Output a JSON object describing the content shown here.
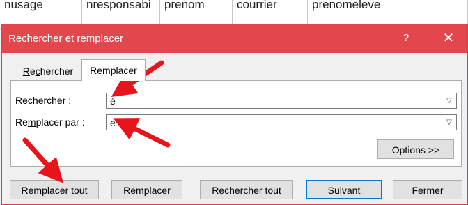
{
  "sheet": {
    "columns": [
      "nusage",
      "nresponsabi",
      "prenom",
      "courrier",
      "prenomeleve"
    ]
  },
  "dialog": {
    "title": "Rechercher et remplacer",
    "help_glyph": "?",
    "close_glyph": "✕",
    "tabs": [
      {
        "label": "Rechercher",
        "active": false
      },
      {
        "label": "Remplacer",
        "active": true
      }
    ],
    "find": {
      "label": "Rechercher :",
      "value": "é"
    },
    "replace": {
      "label": "Remplacer par :",
      "value": "e"
    },
    "buttons": {
      "options": "Options >>",
      "replace_all": "Remplacer tout",
      "replace": "Remplacer",
      "find_all": "Rechercher tout",
      "next": "Suivant",
      "close": "Fermer"
    }
  },
  "colors": {
    "titlebar": "#e4464e",
    "annotation_arrow": "#e8141c",
    "default_button_border": "#0078d7"
  },
  "annotations": {
    "arrow_count": 4,
    "icon": "red-arrow-icon"
  }
}
